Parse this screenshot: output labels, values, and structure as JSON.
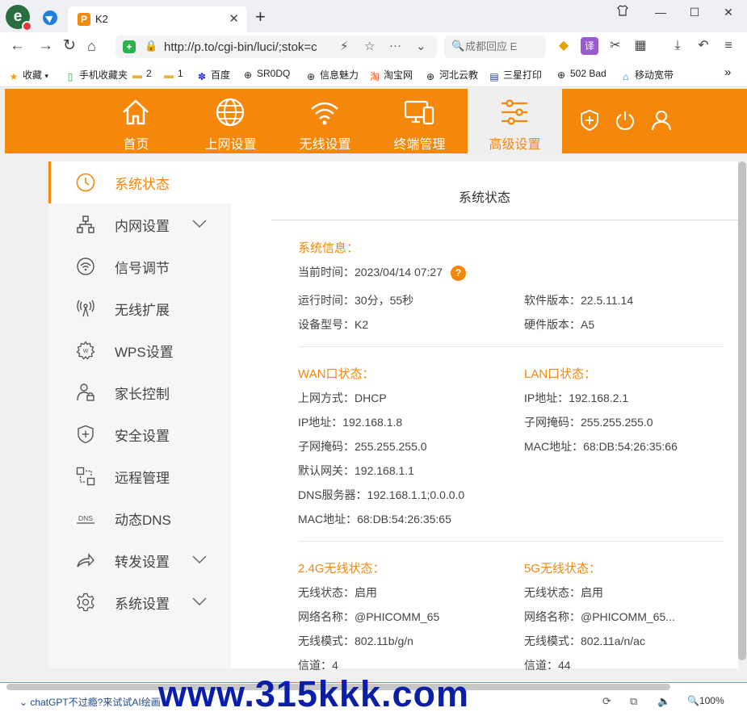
{
  "browser": {
    "tab_title": "K2",
    "tab_favicon_letter": "P",
    "url": "http://p.to/cgi-bin/luci/;stok=c",
    "search_placeholder": "成都回应 E",
    "win_controls": [
      "minimize",
      "maximize",
      "close"
    ],
    "bookmarks": [
      {
        "label": "收藏",
        "icon": "star-icon"
      },
      {
        "label": "手机收藏夹",
        "icon": "phone-icon"
      },
      {
        "label": "2",
        "icon": "folder-icon"
      },
      {
        "label": "1",
        "icon": "folder-icon"
      },
      {
        "label": "百度",
        "icon": "baidu-paw-icon"
      },
      {
        "label": "SR0DQ",
        "icon": "globe-icon"
      },
      {
        "label": "信息魅力",
        "icon": "globe-icon"
      },
      {
        "label": "淘宝网",
        "icon": "taobao-icon"
      },
      {
        "label": "河北云教",
        "icon": "globe-icon"
      },
      {
        "label": "三星打印",
        "icon": "printer-icon"
      },
      {
        "label": "502 Bad",
        "icon": "globe-icon"
      },
      {
        "label": "移动宽带",
        "icon": "home-icon"
      }
    ],
    "bookmarks_more": "»",
    "status_link": "chatGPT不过瘾?来试试AI绘画",
    "zoom": "100%"
  },
  "router": {
    "topnav": [
      {
        "label": "首页",
        "icon": "home-icon"
      },
      {
        "label": "上网设置",
        "icon": "globe-icon"
      },
      {
        "label": "无线设置",
        "icon": "wifi-icon"
      },
      {
        "label": "终端管理",
        "icon": "devices-icon"
      },
      {
        "label": "高级设置",
        "icon": "sliders-icon",
        "active": true
      }
    ],
    "util_icons": [
      "shield-plus-icon",
      "power-icon",
      "user-icon"
    ],
    "sidebar": [
      {
        "label": "系统状态",
        "icon": "clock-icon",
        "active": true
      },
      {
        "label": "内网设置",
        "icon": "network-icon",
        "expandable": true
      },
      {
        "label": "信号调节",
        "icon": "signal-icon"
      },
      {
        "label": "无线扩展",
        "icon": "antenna-icon"
      },
      {
        "label": "WPS设置",
        "icon": "wps-gear-icon"
      },
      {
        "label": "家长控制",
        "icon": "parent-lock-icon"
      },
      {
        "label": "安全设置",
        "icon": "shield-plus-icon"
      },
      {
        "label": "远程管理",
        "icon": "remote-icon"
      },
      {
        "label": "动态DNS",
        "icon": "dns-icon"
      },
      {
        "label": "转发设置",
        "icon": "forward-icon",
        "expandable": true
      },
      {
        "label": "系统设置",
        "icon": "gear-icon",
        "expandable": true
      }
    ],
    "panel_title": "系统状态",
    "system": {
      "title": "系统信息：",
      "current_time": "当前时间：2023/04/14 07:27",
      "uptime": "运行时间：30分，55秒",
      "model": "设备型号：K2",
      "software": "软件版本：22.5.11.14",
      "hardware": "硬件版本：A5"
    },
    "wan": {
      "title": "WAN口状态：",
      "rows": [
        "上网方式：DHCP",
        "IP地址：192.168.1.8",
        "子网掩码：255.255.255.0",
        "默认网关：192.168.1.1",
        "DNS服务器：192.168.1.1;0.0.0.0",
        "MAC地址：68:DB:54:26:35:65"
      ]
    },
    "lan": {
      "title": "LAN口状态：",
      "rows": [
        "IP地址：192.168.2.1",
        "子网掩码：255.255.255.0",
        "MAC地址：68:DB:54:26:35:66"
      ]
    },
    "w24": {
      "title": "2.4G无线状态：",
      "rows": [
        "无线状态：启用",
        "网络名称：@PHICOMM_65",
        "无线模式：802.11b/g/n",
        "信道：4"
      ]
    },
    "w5": {
      "title": "5G无线状态：",
      "rows": [
        "无线状态：启用",
        "网络名称：@PHICOMM_65...",
        "无线模式：802.11a/n/ac",
        "信道：44"
      ]
    }
  },
  "watermark": "www.315kkk.com",
  "colors": {
    "accent": "#f5870a",
    "watermark": "#0a1ea6"
  }
}
